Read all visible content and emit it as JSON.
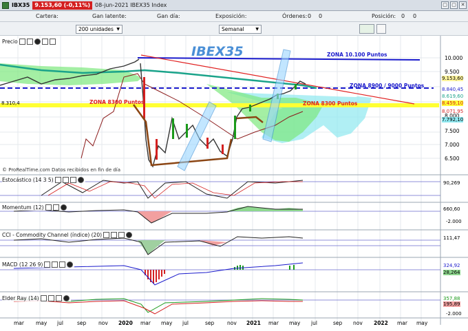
{
  "window": {
    "symbol": "IBX35",
    "price_badge": "9.153,60 (-0,11%)",
    "info": "08-jun-2021 IBEX35 Index",
    "buttons": [
      "▢",
      "▢",
      "✕"
    ]
  },
  "orderbar": {
    "cartera": "Cartera:",
    "latente": "Gan latente:",
    "gandia": "Gan día:",
    "exposicion": "Exposición:",
    "ordenes": "Órdenes:",
    "ordenes_val": "0",
    "ordenes_val2": "0",
    "posicion": "Posición:",
    "posicion_val": "0",
    "posicion_val2": "0"
  },
  "controls": {
    "units": "200 unidades",
    "period": "Semanal"
  },
  "colors": {
    "up": "#1a9a1a",
    "down": "#d42020",
    "resistance": "#1a1acc",
    "support_zone": "#ffff33",
    "cloud": "#7ee87e",
    "cloud2": "#8fe8f0",
    "trend": "#e02020",
    "annotation": "#8b4513"
  },
  "main": {
    "label": "Precio",
    "watermark": "IBEX35",
    "zone_10100": "ZONA 10.100 Puntos",
    "zone_8900": "ZONA 8900 / 9000 Puntos",
    "zone_8300_left": "ZONA 8300 Puntos",
    "zone_8300_right": "ZONA 8300 Puntos",
    "value_left": "8.310,4",
    "credit": "© ProRealTime.com  Datos recibidos en fin de día",
    "y_ticks": [
      "10.000",
      "9.500",
      "9.000",
      "8.500",
      "8.000",
      "7.500",
      "7.000",
      "6.500"
    ],
    "right_labels": [
      "9.153,60",
      "8.840,45",
      "8.619,60",
      "8.459,10",
      "8.071,95",
      "7.792,10"
    ]
  },
  "stoch": {
    "label": "Estocástico (14 3 5)",
    "values": [
      "90,269"
    ]
  },
  "momentum": {
    "label": "Momentum (12)",
    "values": [
      "660,60",
      "-2.000"
    ]
  },
  "cci": {
    "label": "CCI - Commodity Channel (índice) (20)",
    "values": [
      "111,47"
    ]
  },
  "macd": {
    "label": "MACD (12 26 9)",
    "values": [
      "324,92",
      "28,264"
    ]
  },
  "elder": {
    "label": "Elder Ray (14)",
    "values": [
      "357,88",
      "195,89",
      "-2.000"
    ]
  },
  "x_axis": [
    "mar",
    "may",
    "jul",
    "sep",
    "nov",
    "2020",
    "mar",
    "may",
    "jul",
    "sep",
    "nov",
    "2021",
    "mar",
    "may",
    "jul",
    "sep",
    "nov",
    "2022",
    "mar",
    "may"
  ]
}
